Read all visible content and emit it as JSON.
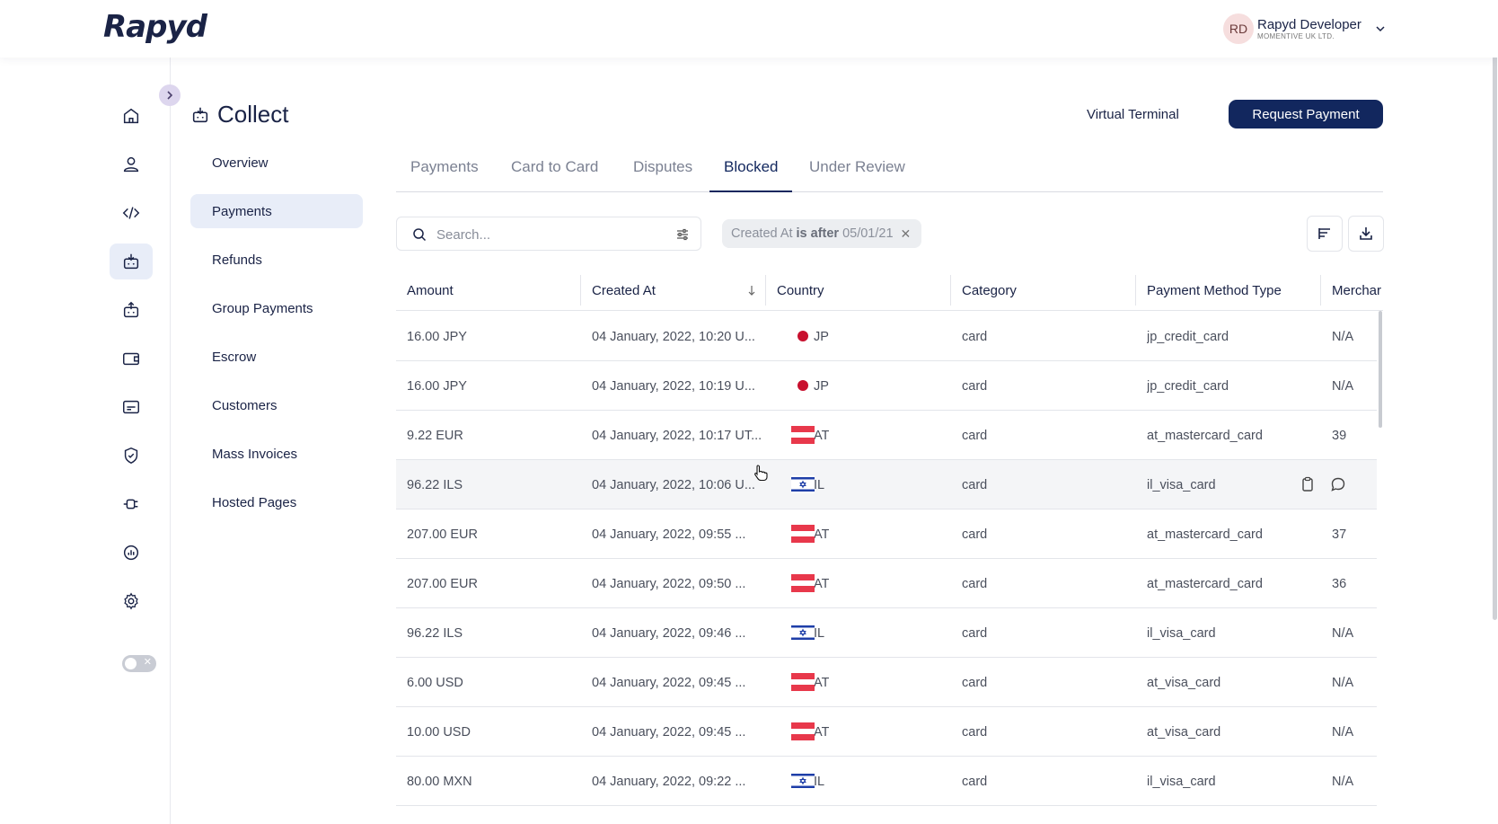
{
  "header": {
    "logo": "Rapyd",
    "user_initials": "RD",
    "user_name": "Rapyd Developer",
    "user_org": "MOMENTIVE UK LTD."
  },
  "rail": {
    "icons": [
      "home-icon",
      "user-icon",
      "code-icon",
      "collect-icon",
      "disburse-icon",
      "wallet-icon",
      "card-icon",
      "shield-check-icon",
      "plug-icon",
      "report-icon",
      "gear-icon"
    ],
    "active": "collect-icon"
  },
  "page": {
    "title": "Collect",
    "virtual_terminal": "Virtual Terminal",
    "request_payment": "Request Payment"
  },
  "subnav": {
    "items": [
      {
        "label": "Overview"
      },
      {
        "label": "Payments"
      },
      {
        "label": "Refunds"
      },
      {
        "label": "Group Payments"
      },
      {
        "label": "Escrow"
      },
      {
        "label": "Customers"
      },
      {
        "label": "Mass Invoices"
      },
      {
        "label": "Hosted Pages"
      }
    ],
    "active": "Payments"
  },
  "tabs": {
    "items": [
      {
        "label": "Payments"
      },
      {
        "label": "Card to Card"
      },
      {
        "label": "Disputes"
      },
      {
        "label": "Blocked"
      },
      {
        "label": "Under Review"
      }
    ],
    "active": "Blocked"
  },
  "search": {
    "placeholder": "Search..."
  },
  "filter_chip": {
    "field": "Created At",
    "operator": "is after",
    "value": "05/01/21"
  },
  "table": {
    "columns": [
      "Amount",
      "Created At",
      "Country",
      "Category",
      "Payment Method Type",
      "Merchar"
    ],
    "rows": [
      {
        "amount": "16.00 JPY",
        "created": "04 January, 2022, 10:20 U...",
        "flag": "JP",
        "country": "JP",
        "category": "card",
        "method": "jp_credit_card",
        "merchant": "N/A"
      },
      {
        "amount": "16.00 JPY",
        "created": "04 January, 2022, 10:19 U...",
        "flag": "JP",
        "country": "JP",
        "category": "card",
        "method": "jp_credit_card",
        "merchant": "N/A"
      },
      {
        "amount": "9.22 EUR",
        "created": "04 January, 2022, 10:17 UT...",
        "flag": "AT",
        "country": "AT",
        "category": "card",
        "method": "at_mastercard_card",
        "merchant": "39"
      },
      {
        "amount": "96.22 ILS",
        "created": "04 January, 2022, 10:06 U...",
        "flag": "IL",
        "country": "IL",
        "category": "card",
        "method": "il_visa_card",
        "merchant": ""
      },
      {
        "amount": "207.00 EUR",
        "created": "04 January, 2022, 09:55 ...",
        "flag": "AT",
        "country": "AT",
        "category": "card",
        "method": "at_mastercard_card",
        "merchant": "37"
      },
      {
        "amount": "207.00 EUR",
        "created": "04 January, 2022, 09:50 ...",
        "flag": "AT",
        "country": "AT",
        "category": "card",
        "method": "at_mastercard_card",
        "merchant": "36"
      },
      {
        "amount": "96.22 ILS",
        "created": "04 January, 2022, 09:46 ...",
        "flag": "IL",
        "country": "IL",
        "category": "card",
        "method": "il_visa_card",
        "merchant": "N/A"
      },
      {
        "amount": "6.00 USD",
        "created": "04 January, 2022, 09:45 ...",
        "flag": "AT",
        "country": "AT",
        "category": "card",
        "method": "at_visa_card",
        "merchant": "N/A"
      },
      {
        "amount": "10.00 USD",
        "created": "04 January, 2022, 09:45 ...",
        "flag": "AT",
        "country": "AT",
        "category": "card",
        "method": "at_visa_card",
        "merchant": "N/A"
      },
      {
        "amount": "80.00 MXN",
        "created": "04 January, 2022, 09:22 ...",
        "flag": "IL",
        "country": "IL",
        "category": "card",
        "method": "il_visa_card",
        "merchant": "N/A"
      }
    ],
    "hover_row_actions": [
      "clipboard-icon",
      "comment-icon"
    ]
  },
  "colors": {
    "primary": "#12275e",
    "active_bg": "#e8edf8",
    "at_red": "#e8384b",
    "il_blue": "#1e3ea8",
    "jp_red": "#c8102e"
  }
}
